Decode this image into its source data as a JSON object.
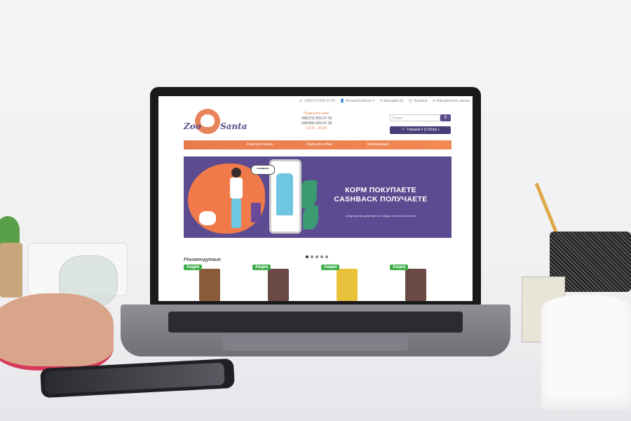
{
  "site": {
    "logo_left": "Zoo",
    "logo_right": "Santa",
    "topbar": {
      "phone": "☏ +38(073)-009-37-39",
      "account": "👤 Личный кабинет ▾",
      "wishlist": "♥ Закладки (0)",
      "cart_link": "🛒 Корзина",
      "checkout": "➦ Оформление заказа"
    },
    "contacts": {
      "callus": "Позвоните нам!",
      "phone1": "+38(073)-009-37-39",
      "phone2": "+38(099)-009-37-39",
      "hours": "10:00 - 20:00"
    },
    "search": {
      "placeholder": "Поиск",
      "icon": "search-icon"
    },
    "cart_button": "🛒 Товаров 0 (0.00грн.)",
    "nav": [
      "Корм для кошек",
      "Корм для собак",
      "Информация"
    ],
    "banner": {
      "speech": "CASHBACK",
      "title_line1": "КОРМ ПОКУПАЕТЕ",
      "title_line2": "CASHBACK ПОЛУЧАЕТЕ",
      "note": "предложение действует на товары с меткой cashback"
    },
    "slider_dots": 5,
    "slider_active": 0,
    "recommended_title": "Рекомендуемые",
    "products": [
      {
        "badge": "Акция",
        "color": "#8a5a3a"
      },
      {
        "badge": "Акция",
        "color": "#6a4a42"
      },
      {
        "badge": "Акция",
        "color": "#e8c23a"
      },
      {
        "badge": "Акция",
        "color": "#6a4a42"
      }
    ],
    "colors": {
      "accent_orange": "#f08a52",
      "brand_purple": "#5a4b8a",
      "banner_purple": "#5d4b91",
      "sale_green": "#3fae4a"
    }
  }
}
